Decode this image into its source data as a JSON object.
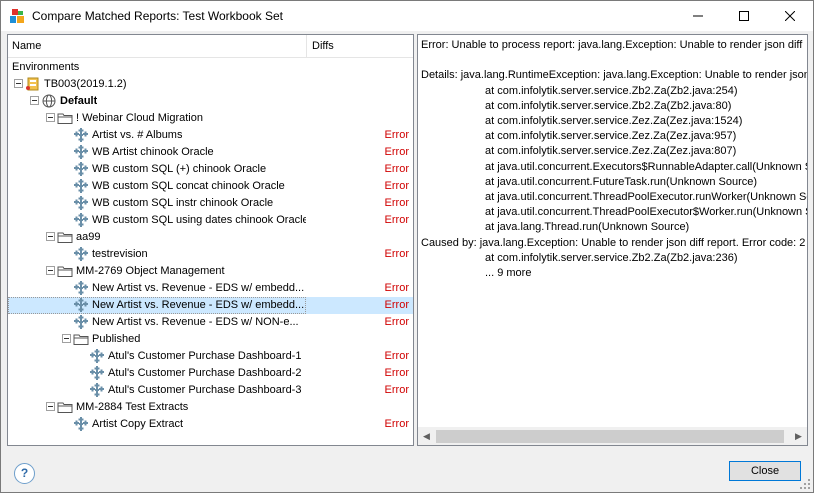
{
  "window": {
    "title": "Compare Matched Reports: Test Workbook Set"
  },
  "tree": {
    "col_name": "Name",
    "col_diffs": "Diffs",
    "rows": [
      {
        "label": "Environments",
        "depth": 0,
        "kind": "text",
        "expander": false,
        "diff": ""
      },
      {
        "label": "TB003(2019.1.2)",
        "depth": 0,
        "kind": "server",
        "expander": true,
        "diff": ""
      },
      {
        "label": "Default",
        "depth": 1,
        "kind": "globe",
        "expander": true,
        "diff": "",
        "bold": true
      },
      {
        "label": "! Webinar Cloud Migration",
        "depth": 2,
        "kind": "folder",
        "expander": true,
        "diff": ""
      },
      {
        "label": "Artist vs. # Albums",
        "depth": 3,
        "kind": "workbook",
        "expander": false,
        "diff": "Error"
      },
      {
        "label": "WB Artist chinook Oracle",
        "depth": 3,
        "kind": "workbook",
        "expander": false,
        "diff": "Error"
      },
      {
        "label": "WB custom SQL (+) chinook Oracle",
        "depth": 3,
        "kind": "workbook",
        "expander": false,
        "diff": "Error"
      },
      {
        "label": "WB custom SQL concat chinook Oracle",
        "depth": 3,
        "kind": "workbook",
        "expander": false,
        "diff": "Error"
      },
      {
        "label": "WB custom SQL instr chinook Oracle",
        "depth": 3,
        "kind": "workbook",
        "expander": false,
        "diff": "Error"
      },
      {
        "label": "WB custom SQL using dates chinook Oracle",
        "depth": 3,
        "kind": "workbook",
        "expander": false,
        "diff": "Error"
      },
      {
        "label": "aa99",
        "depth": 2,
        "kind": "folder",
        "expander": true,
        "diff": ""
      },
      {
        "label": "testrevision",
        "depth": 3,
        "kind": "workbook",
        "expander": false,
        "diff": "Error"
      },
      {
        "label": "MM-2769 Object Management",
        "depth": 2,
        "kind": "folder",
        "expander": true,
        "diff": ""
      },
      {
        "label": "New Artist vs. Revenue - EDS w/ embedd...",
        "depth": 3,
        "kind": "workbook",
        "expander": false,
        "diff": "Error"
      },
      {
        "label": "New Artist vs. Revenue - EDS w/ embedd...",
        "depth": 3,
        "kind": "workbook",
        "expander": false,
        "diff": "Error",
        "selected": true
      },
      {
        "label": "New Artist vs. Revenue - EDS w/ NON-e...",
        "depth": 3,
        "kind": "workbook",
        "expander": false,
        "diff": "Error"
      },
      {
        "label": "Published",
        "depth": 3,
        "kind": "folder",
        "expander": true,
        "diff": ""
      },
      {
        "label": "Atul's Customer Purchase Dashboard-1",
        "depth": 4,
        "kind": "workbook",
        "expander": false,
        "diff": "Error"
      },
      {
        "label": "Atul's Customer Purchase Dashboard-2",
        "depth": 4,
        "kind": "workbook",
        "expander": false,
        "diff": "Error"
      },
      {
        "label": "Atul's Customer Purchase Dashboard-3",
        "depth": 4,
        "kind": "workbook",
        "expander": false,
        "diff": "Error"
      },
      {
        "label": "MM-2884 Test Extracts",
        "depth": 2,
        "kind": "folder",
        "expander": true,
        "diff": ""
      },
      {
        "label": "Artist Copy Extract",
        "depth": 3,
        "kind": "workbook",
        "expander": false,
        "diff": "Error"
      }
    ]
  },
  "detail": {
    "lines": [
      {
        "text": "Error: Unable to process report: java.lang.Exception: Unable to render json diff",
        "indent": false
      },
      {
        "text": "",
        "indent": false
      },
      {
        "text": "Details: java.lang.RuntimeException: java.lang.Exception: Unable to render json",
        "indent": false
      },
      {
        "text": "at com.infolytik.server.service.Zb2.Za(Zb2.java:254)",
        "indent": true
      },
      {
        "text": "at com.infolytik.server.service.Zb2.Za(Zb2.java:80)",
        "indent": true
      },
      {
        "text": "at com.infolytik.server.service.Zez.Za(Zez.java:1524)",
        "indent": true
      },
      {
        "text": "at com.infolytik.server.service.Zez.Za(Zez.java:957)",
        "indent": true
      },
      {
        "text": "at com.infolytik.server.service.Zez.Za(Zez.java:807)",
        "indent": true
      },
      {
        "text": "at java.util.concurrent.Executors$RunnableAdapter.call(Unknown S",
        "indent": true
      },
      {
        "text": "at java.util.concurrent.FutureTask.run(Unknown Source)",
        "indent": true
      },
      {
        "text": "at java.util.concurrent.ThreadPoolExecutor.runWorker(Unknown So",
        "indent": true
      },
      {
        "text": "at java.util.concurrent.ThreadPoolExecutor$Worker.run(Unknown S",
        "indent": true
      },
      {
        "text": "at java.lang.Thread.run(Unknown Source)",
        "indent": true
      },
      {
        "text": "Caused by: java.lang.Exception: Unable to render json diff report. Error code: 2",
        "indent": false
      },
      {
        "text": "at com.infolytik.server.service.Zb2.Za(Zb2.java:236)",
        "indent": true
      },
      {
        "text": "... 9 more",
        "indent": true
      }
    ]
  },
  "buttons": {
    "help": "?",
    "close": "Close"
  },
  "colors": {
    "error": "#d00000",
    "selection": "#cce8ff",
    "accent": "#0078d7"
  }
}
